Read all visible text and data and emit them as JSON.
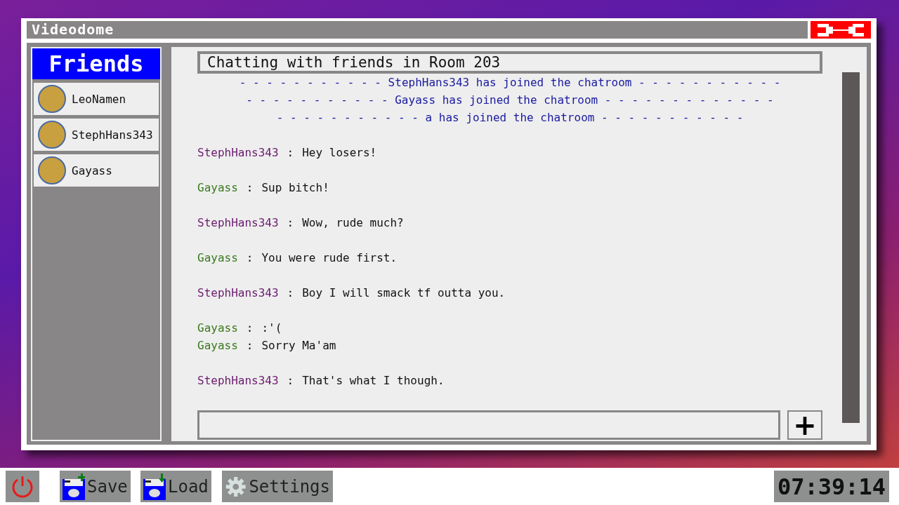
{
  "window": {
    "title": "Videodome"
  },
  "friends": {
    "title": "Friends",
    "items": [
      {
        "name": "LeoNamen"
      },
      {
        "name": "StephHans343"
      },
      {
        "name": "Gayass"
      }
    ]
  },
  "chat": {
    "title": "Chatting with friends in Room 203",
    "system": [
      "- - - - - - - - - - - StephHans343 has joined the chatroom - - - - - - - - - - -",
      "- - - - - - - - - - - Gayass has joined the chatroom - - - - - - - - - - - - -",
      "- - - - - - - - - - - a has joined the chatroom - - - - - - - - - - -"
    ],
    "groups": [
      {
        "messages": [
          {
            "user": "StephHans343",
            "color": "#6a1b6e",
            "text": "Hey losers!"
          }
        ]
      },
      {
        "messages": [
          {
            "user": "Gayass",
            "color": "#3b7a1e",
            "text": "Sup bitch!"
          }
        ]
      },
      {
        "messages": [
          {
            "user": "StephHans343",
            "color": "#6a1b6e",
            "text": "Wow, rude much?"
          }
        ]
      },
      {
        "messages": [
          {
            "user": "Gayass",
            "color": "#3b7a1e",
            "text": "You were rude first."
          }
        ]
      },
      {
        "messages": [
          {
            "user": "StephHans343",
            "color": "#6a1b6e",
            "text": "Boy I will smack tf outta you."
          }
        ]
      },
      {
        "messages": [
          {
            "user": "Gayass",
            "color": "#3b7a1e",
            "text": ":'("
          },
          {
            "user": "Gayass",
            "color": "#3b7a1e",
            "text": "Sorry Ma'am"
          }
        ]
      },
      {
        "messages": [
          {
            "user": "StephHans343",
            "color": "#6a1b6e",
            "text": "That's what I though."
          }
        ]
      }
    ],
    "separator": ":",
    "send": "+"
  },
  "taskbar": {
    "buttons": [
      {
        "kind": "power"
      },
      {
        "kind": "save",
        "label": "Save"
      },
      {
        "kind": "load",
        "label": "Load"
      },
      {
        "kind": "settings",
        "label": "Settings"
      }
    ],
    "clock": "07:39:14"
  }
}
